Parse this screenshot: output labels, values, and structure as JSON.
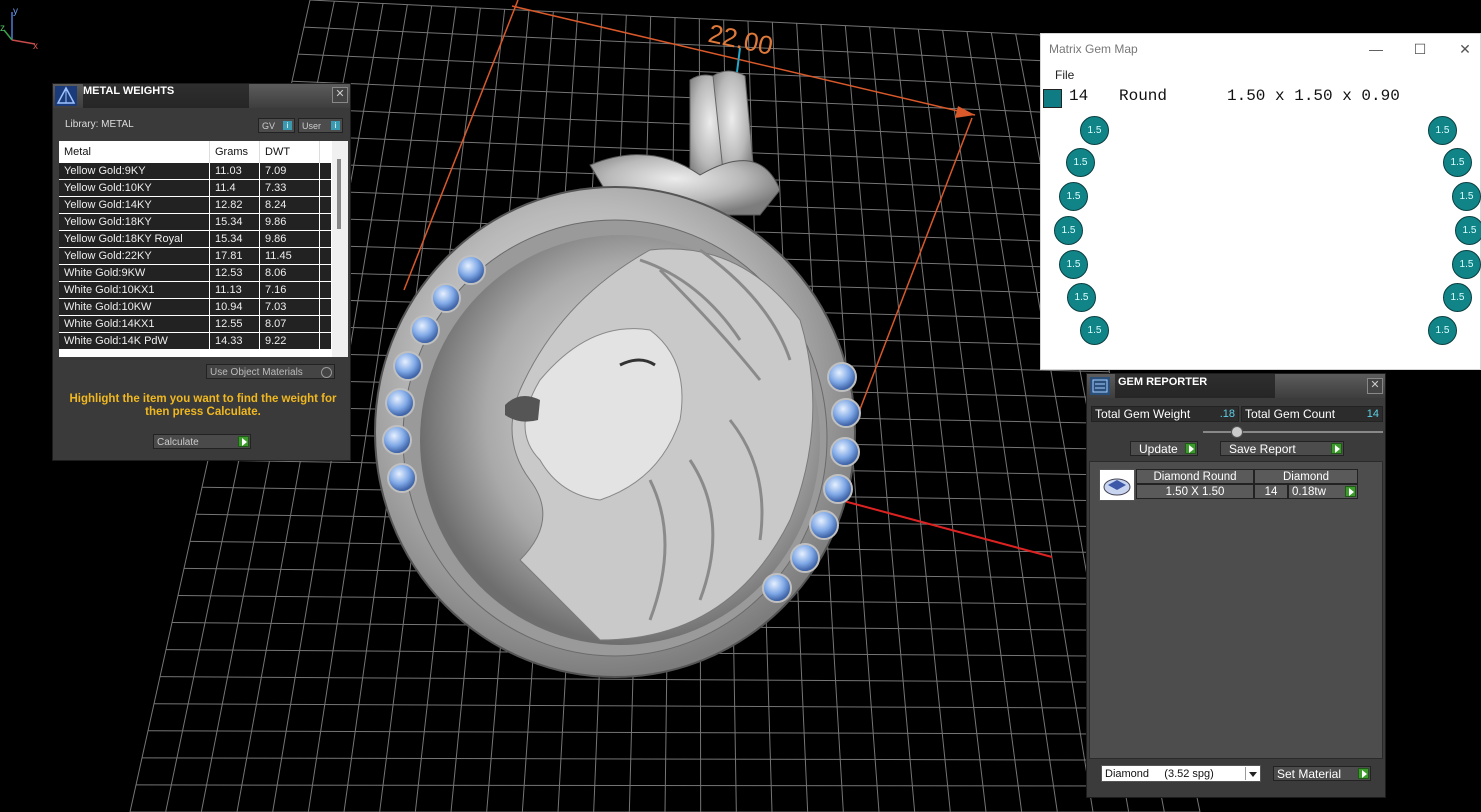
{
  "viewport": {
    "dimension_label": "22.00",
    "axis_labels": {
      "y": "y",
      "z": "z",
      "x": "x"
    }
  },
  "metal_weights": {
    "title": "METAL WEIGHTS",
    "library": "Library: METAL",
    "gv_label": "GV",
    "user_label": "User",
    "columns": [
      "Metal",
      "Grams",
      "DWT"
    ],
    "rows": [
      {
        "metal": "Yellow Gold:9KY",
        "grams": "11.03",
        "dwt": "7.09"
      },
      {
        "metal": "Yellow Gold:10KY",
        "grams": "11.4",
        "dwt": "7.33"
      },
      {
        "metal": "Yellow Gold:14KY",
        "grams": "12.82",
        "dwt": "8.24"
      },
      {
        "metal": "Yellow Gold:18KY",
        "grams": "15.34",
        "dwt": "9.86"
      },
      {
        "metal": "Yellow Gold:18KY Royal",
        "grams": "15.34",
        "dwt": "9.86"
      },
      {
        "metal": "Yellow Gold:22KY",
        "grams": "17.81",
        "dwt": "11.45"
      },
      {
        "metal": "White Gold:9KW",
        "grams": "12.53",
        "dwt": "8.06"
      },
      {
        "metal": "White Gold:10KX1",
        "grams": "11.13",
        "dwt": "7.16"
      },
      {
        "metal": "White Gold:10KW",
        "grams": "10.94",
        "dwt": "7.03"
      },
      {
        "metal": "White Gold:14KX1",
        "grams": "12.55",
        "dwt": "8.07"
      },
      {
        "metal": "White Gold:14K PdW",
        "grams": "14.33",
        "dwt": "9.22"
      }
    ],
    "use_object_materials": "Use Object Materials",
    "hint": "Highlight the item you want to find the weight for then press Calculate.",
    "calculate": "Calculate",
    "close": "✕"
  },
  "gem_map": {
    "title": "Matrix Gem Map",
    "menu_file": "File",
    "count": "14",
    "shape": "Round",
    "size": "1.50 x 1.50 x 0.90",
    "gem_label": "1.5",
    "swatch_color": "#0f7b82"
  },
  "gem_reporter": {
    "title": "GEM REPORTER",
    "total_weight_label": "Total Gem Weight",
    "total_weight": ".18",
    "total_count_label": "Total Gem Count",
    "total_count": "14",
    "update": "Update",
    "save_report": "Save Report",
    "item": {
      "name": "Diamond Round",
      "material": "Diamond",
      "size": "1.50 X 1.50",
      "count": "14",
      "weight": "0.18tw"
    },
    "material_select": "Diamond     (3.52 spg)",
    "set_material": "Set Material",
    "close": "✕"
  }
}
